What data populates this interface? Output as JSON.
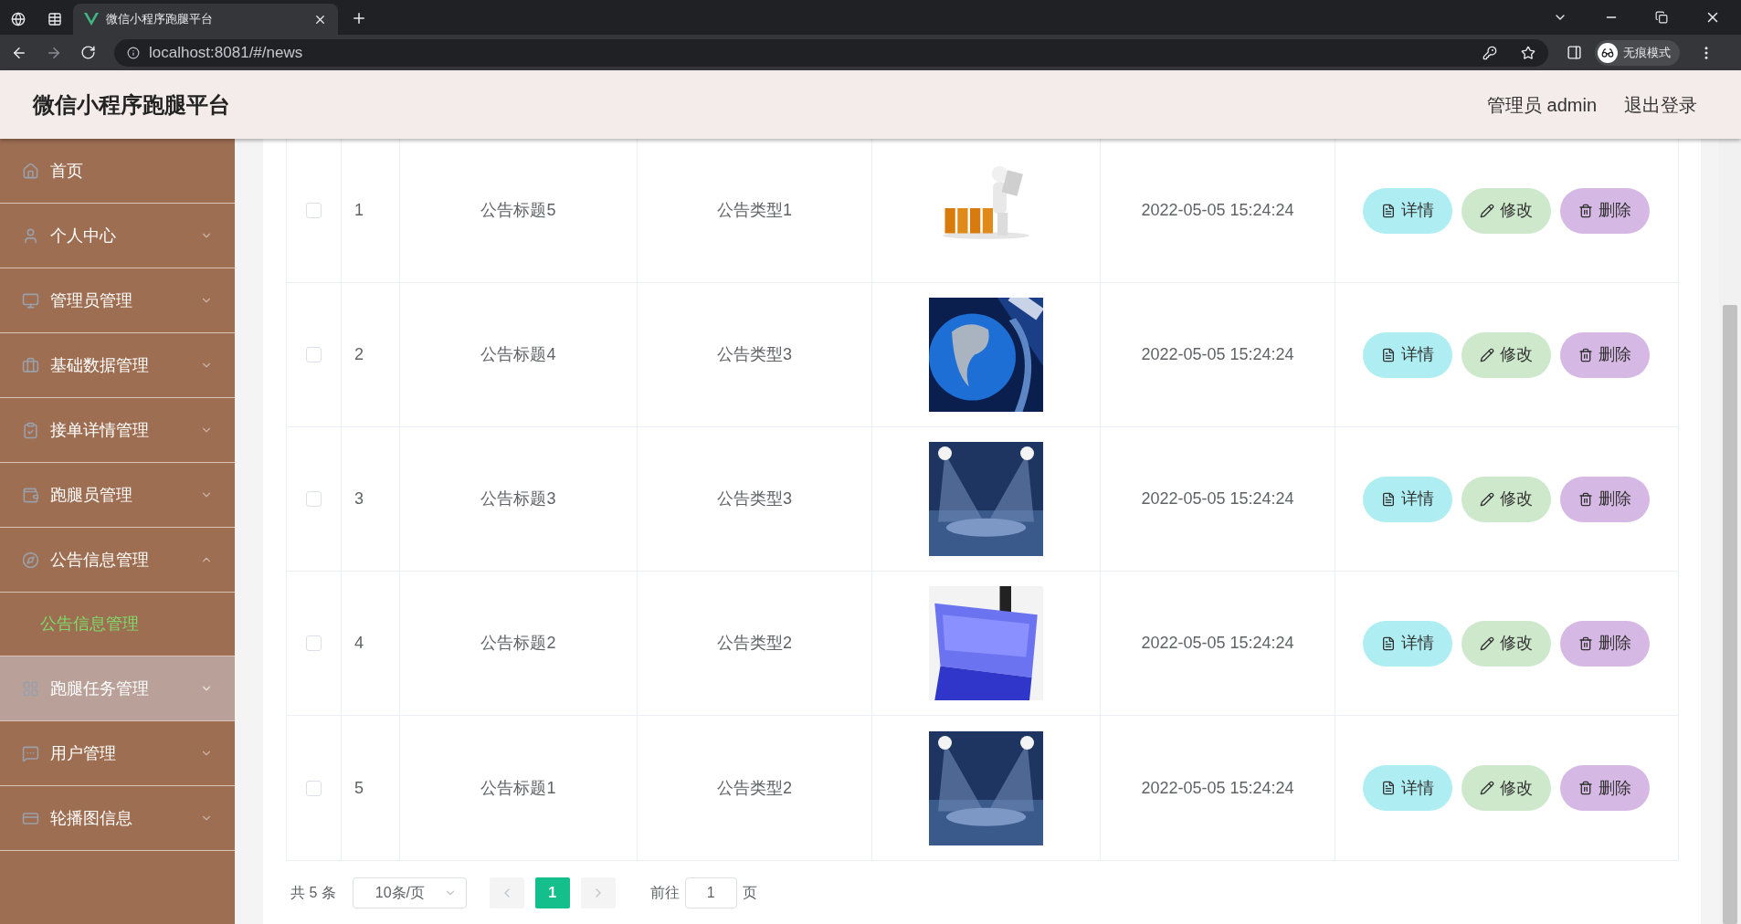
{
  "browser": {
    "tabs": [
      {
        "kind": "icon",
        "selected": false
      },
      {
        "kind": "icon",
        "selected": false
      },
      {
        "kind": "page",
        "title": "微信小程序跑腿平台",
        "selected": true
      }
    ],
    "url": "localhost:8081/#/news",
    "profile_label": "无痕模式"
  },
  "header": {
    "title": "微信小程序跑腿平台",
    "user": "管理员 admin",
    "logout": "退出登录"
  },
  "sidebar": {
    "items": [
      {
        "label": "首页",
        "hovered": false
      },
      {
        "label": "个人中心",
        "expanded": false,
        "hovered": false
      },
      {
        "label": "管理员管理",
        "expanded": false,
        "hovered": false
      },
      {
        "label": "基础数据管理",
        "expanded": false,
        "hovered": false
      },
      {
        "label": "接单详情管理",
        "expanded": false,
        "hovered": false
      },
      {
        "label": "跑腿员管理",
        "expanded": false,
        "hovered": false
      },
      {
        "label": "公告信息管理",
        "expanded": true,
        "hovered": false,
        "children": [
          {
            "label": "公告信息管理",
            "selected": true
          }
        ]
      },
      {
        "label": "跑腿任务管理",
        "expanded": false,
        "hovered": true
      },
      {
        "label": "用户管理",
        "expanded": false,
        "hovered": false
      },
      {
        "label": "轮播图信息",
        "expanded": false,
        "hovered": false
      }
    ]
  },
  "table": {
    "rows": [
      {
        "checked": false,
        "index": "1",
        "title": "公告标题5",
        "type": "公告类型1",
        "time": "2022-05-05 15:24:24",
        "actions": [
          {
            "kind": "detail",
            "label": "详情"
          },
          {
            "kind": "edit",
            "label": "修改"
          },
          {
            "kind": "delete",
            "label": "删除"
          }
        ]
      },
      {
        "checked": false,
        "index": "2",
        "title": "公告标题4",
        "type": "公告类型3",
        "time": "2022-05-05 15:24:24",
        "actions": [
          {
            "kind": "detail",
            "label": "详情"
          },
          {
            "kind": "edit",
            "label": "修改"
          },
          {
            "kind": "delete",
            "label": "删除"
          }
        ]
      },
      {
        "checked": false,
        "index": "3",
        "title": "公告标题3",
        "type": "公告类型3",
        "time": "2022-05-05 15:24:24",
        "actions": [
          {
            "kind": "detail",
            "label": "详情"
          },
          {
            "kind": "edit",
            "label": "修改"
          },
          {
            "kind": "delete",
            "label": "删除"
          }
        ]
      },
      {
        "checked": false,
        "index": "4",
        "title": "公告标题2",
        "type": "公告类型2",
        "time": "2022-05-05 15:24:24",
        "actions": [
          {
            "kind": "detail",
            "label": "详情"
          },
          {
            "kind": "edit",
            "label": "修改"
          },
          {
            "kind": "delete",
            "label": "删除"
          }
        ]
      },
      {
        "checked": false,
        "index": "5",
        "title": "公告标题1",
        "type": "公告类型2",
        "time": "2022-05-05 15:24:24",
        "actions": [
          {
            "kind": "detail",
            "label": "详情"
          },
          {
            "kind": "edit",
            "label": "修改"
          },
          {
            "kind": "delete",
            "label": "删除"
          }
        ]
      }
    ]
  },
  "pagination": {
    "total": "共 5 条",
    "page_size": "10条/页",
    "pages": [
      {
        "label": "1",
        "selected": true
      }
    ],
    "goto_label": "前往",
    "goto_value": "1",
    "goto_suffix": "页"
  }
}
